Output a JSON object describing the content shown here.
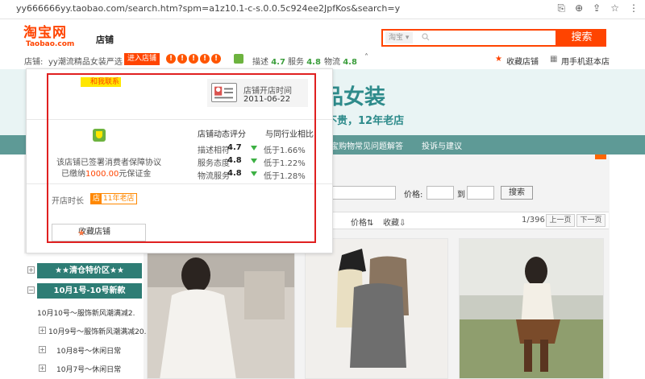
{
  "browser": {
    "url": "yy666666yy.taobao.com/search.htm?spm=a1z10.1-c-s.0.0.5c924ee2JpfKos&search=y",
    "icons": [
      "translate-icon",
      "zoom-icon",
      "share-icon",
      "star-icon",
      "more-icon"
    ]
  },
  "header": {
    "logo_main": "淘宝网",
    "logo_sub": "Taobao.com",
    "shop_label": "店铺",
    "search_scope": "淘宝",
    "search_placeholder": "",
    "search_button": "搜索"
  },
  "shopbar": {
    "store_prefix": "店铺:",
    "store_name": "yy潮流精品女装严选",
    "enter_button": "进入店铺",
    "scores": [
      {
        "label": "描述",
        "value": "4.7"
      },
      {
        "label": "服务",
        "value": "4.8"
      },
      {
        "label": "物流",
        "value": "4.8"
      }
    ],
    "favorite_store": "收藏店铺",
    "mobile_store": "用手机逛本店"
  },
  "banner": {
    "title": "品女装",
    "subtitle": "不贵，12年老店"
  },
  "nav": {
    "items": [
      "宝购物常见问题解答",
      "投诉与建议"
    ]
  },
  "filter": {
    "price_label": "价格:",
    "to_label": "到",
    "search_button": "搜索"
  },
  "sortbar": {
    "items": [
      "价格",
      "收藏"
    ],
    "page_indicator": "1/396",
    "prev": "上一页",
    "next": "下一页"
  },
  "categories": {
    "headers": [
      "★★清仓特价区★★",
      "10月1号-10号新款"
    ],
    "items": [
      "10月10号～服饰新风潮满减2.",
      "10月9号～服饰新风潮满减20.",
      "10月8号～休闲日常",
      "10月7号～休闲日常"
    ]
  },
  "popup": {
    "contact": "和我联系",
    "open_time_label": "店铺开店时间",
    "open_time_value": "2011-06-22",
    "guarantee_line1": "该店铺已签署消费者保障协议",
    "guarantee_prefix": "已缴纳",
    "guarantee_amount": "1000.00",
    "guarantee_suffix": "元保证金",
    "rating_header": "店铺动态评分",
    "compare_header": "与同行业相比",
    "ratings": [
      {
        "name": "描述相符",
        "score": "4.7",
        "compare": "低于1.66%"
      },
      {
        "name": "服务态度",
        "score": "4.8",
        "compare": "低于1.22%"
      },
      {
        "name": "物流服务",
        "score": "4.8",
        "compare": "低于1.28%"
      }
    ],
    "age_label": "开店时长",
    "age_icon": "店",
    "age_value": "11年老店",
    "favorite_button": "收藏店铺"
  },
  "colors": {
    "brand": "#ff4400",
    "nav": "#5e9a96",
    "highlight_box": "#e02020",
    "score_green": "#3c9e3c"
  }
}
